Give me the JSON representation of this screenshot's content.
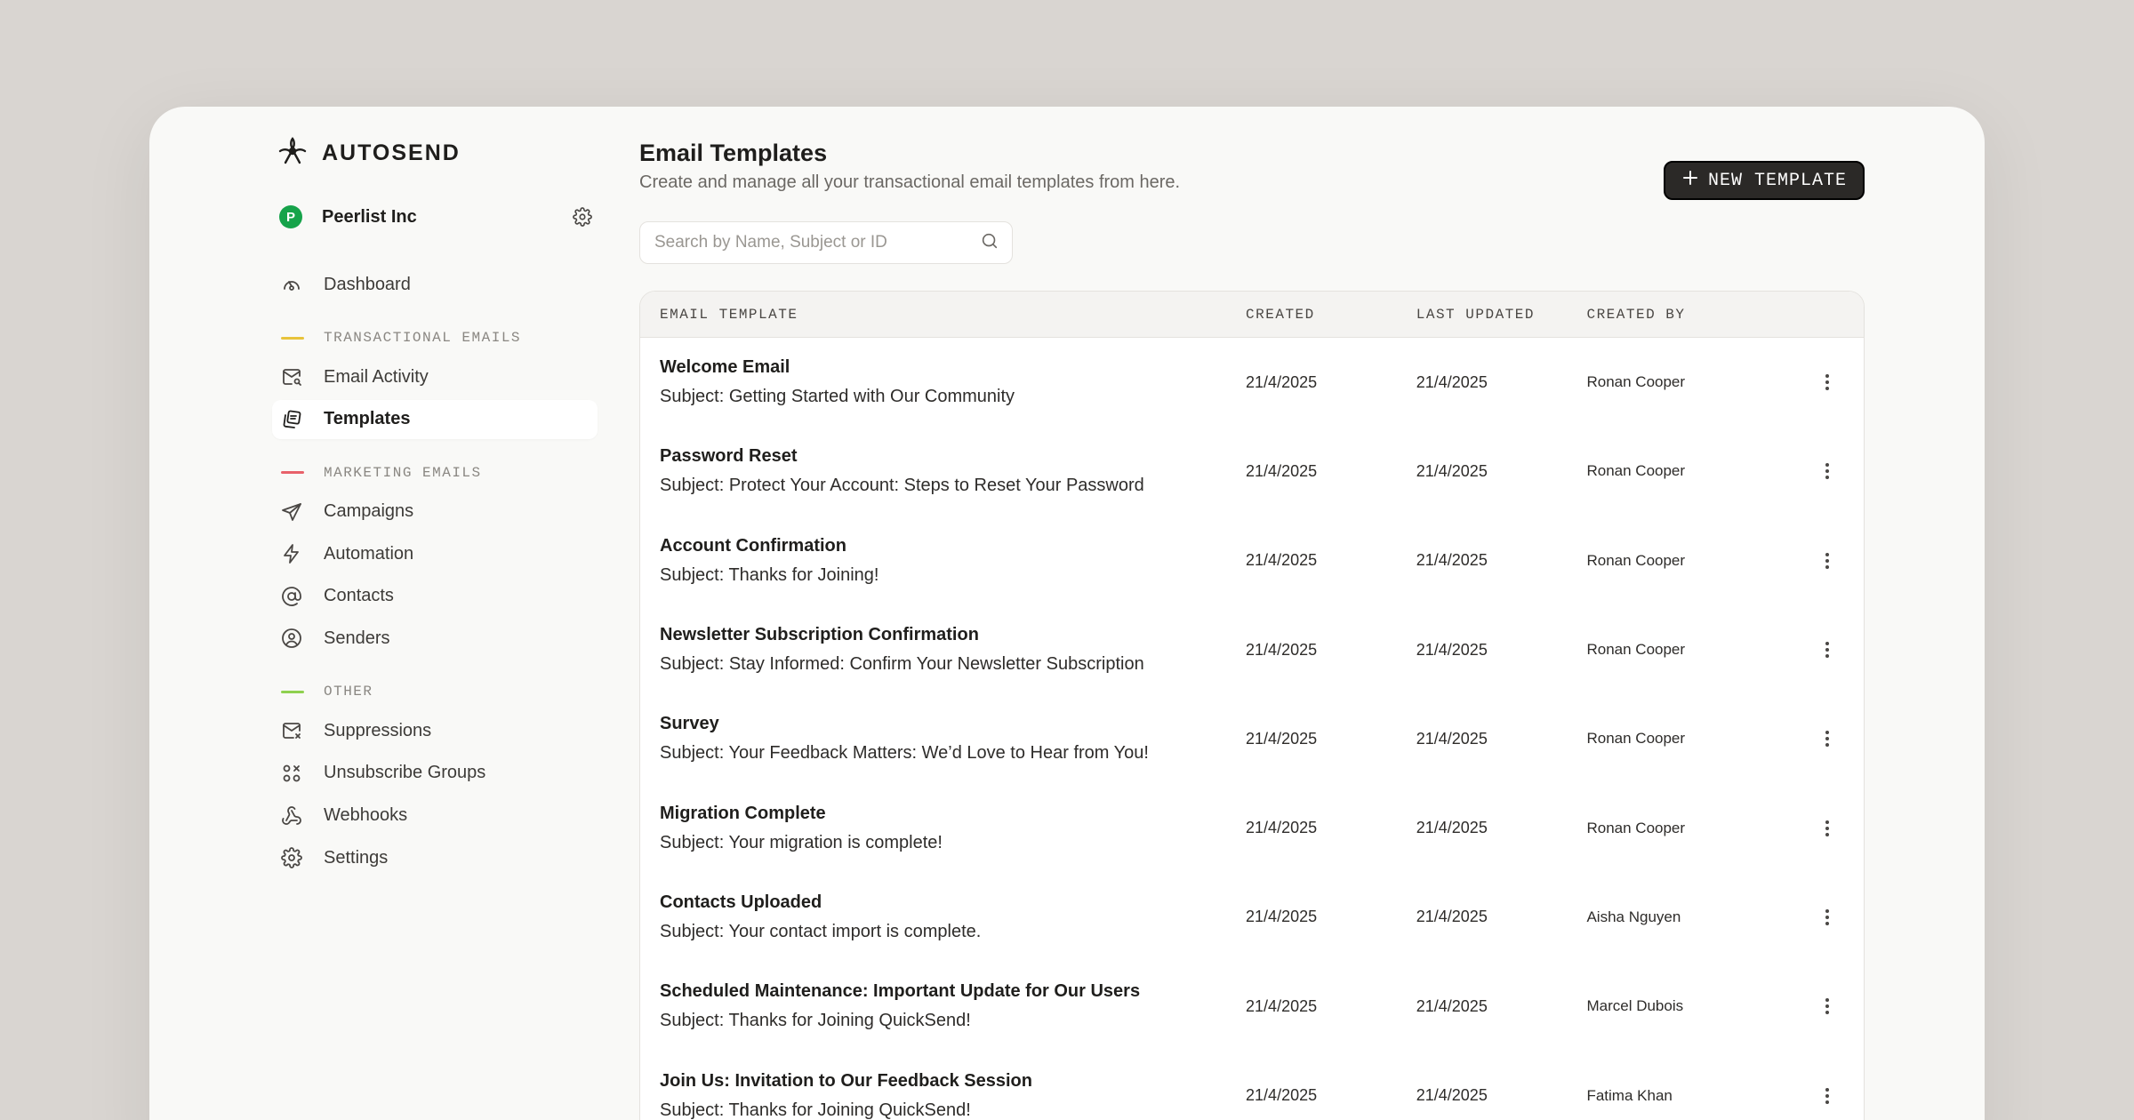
{
  "brand": {
    "name": "AUTOSEND"
  },
  "org": {
    "initial": "P",
    "name": "Peerlist Inc",
    "avatar_color": "#16a34a"
  },
  "sidebar": {
    "dashboard": {
      "label": "Dashboard",
      "icon": "dashboard-gauge-icon"
    },
    "sections": [
      {
        "title": "TRANSACTIONAL EMAILS",
        "accent": "#e8c33a",
        "items": [
          {
            "label": "Email Activity",
            "icon": "mail-search-icon",
            "active": false
          },
          {
            "label": "Templates",
            "icon": "templates-icon",
            "active": true
          }
        ]
      },
      {
        "title": "MARKETING EMAILS",
        "accent": "#e8616a",
        "items": [
          {
            "label": "Campaigns",
            "icon": "paper-plane-icon",
            "active": false
          },
          {
            "label": "Automation",
            "icon": "lightning-icon",
            "active": false
          },
          {
            "label": "Contacts",
            "icon": "at-sign-icon",
            "active": false
          },
          {
            "label": "Senders",
            "icon": "user-circle-icon",
            "active": false
          }
        ]
      },
      {
        "title": "OTHER",
        "accent": "#8fd14f",
        "items": [
          {
            "label": "Suppressions",
            "icon": "mail-x-icon",
            "active": false
          },
          {
            "label": "Unsubscribe Groups",
            "icon": "groups-icon",
            "active": false
          },
          {
            "label": "Webhooks",
            "icon": "webhook-icon",
            "active": false
          },
          {
            "label": "Settings",
            "icon": "gear-icon",
            "active": false
          }
        ]
      }
    ]
  },
  "header": {
    "title": "Email Templates",
    "subtitle": "Create and manage all your transactional email templates from here.",
    "new_button": "NEW TEMPLATE"
  },
  "search": {
    "placeholder": "Search by Name, Subject or ID",
    "value": ""
  },
  "table": {
    "columns": [
      "EMAIL TEMPLATE",
      "CREATED",
      "LAST UPDATED",
      "CREATED BY"
    ],
    "rows": [
      {
        "name": "Welcome Email",
        "subject": "Subject: Getting Started with Our Community",
        "created": "21/4/2025",
        "updated": "21/4/2025",
        "by": "Ronan Cooper"
      },
      {
        "name": "Password Reset",
        "subject": "Subject: Protect Your Account: Steps to Reset Your Password",
        "created": "21/4/2025",
        "updated": "21/4/2025",
        "by": "Ronan Cooper"
      },
      {
        "name": "Account Confirmation",
        "subject": "Subject: Thanks for Joining!",
        "created": "21/4/2025",
        "updated": "21/4/2025",
        "by": "Ronan Cooper"
      },
      {
        "name": "Newsletter Subscription Confirmation",
        "subject": "Subject: Stay Informed: Confirm Your Newsletter Subscription",
        "created": "21/4/2025",
        "updated": "21/4/2025",
        "by": "Ronan Cooper"
      },
      {
        "name": "Survey",
        "subject": "Subject: Your Feedback Matters: We’d Love to Hear from You!",
        "created": "21/4/2025",
        "updated": "21/4/2025",
        "by": "Ronan Cooper"
      },
      {
        "name": "Migration Complete",
        "subject": "Subject: Your migration is complete!",
        "created": "21/4/2025",
        "updated": "21/4/2025",
        "by": "Ronan Cooper"
      },
      {
        "name": "Contacts Uploaded",
        "subject": "Subject: Your contact import is complete.",
        "created": "21/4/2025",
        "updated": "21/4/2025",
        "by": "Aisha Nguyen"
      },
      {
        "name": "Scheduled Maintenance: Important Update for Our Users",
        "subject": "Subject: Thanks for Joining QuickSend!",
        "created": "21/4/2025",
        "updated": "21/4/2025",
        "by": "Marcel Dubois"
      },
      {
        "name": "Join Us: Invitation to Our Feedback Session",
        "subject": "Subject: Thanks for Joining QuickSend!",
        "created": "21/4/2025",
        "updated": "21/4/2025",
        "by": "Fatima Khan"
      }
    ]
  }
}
